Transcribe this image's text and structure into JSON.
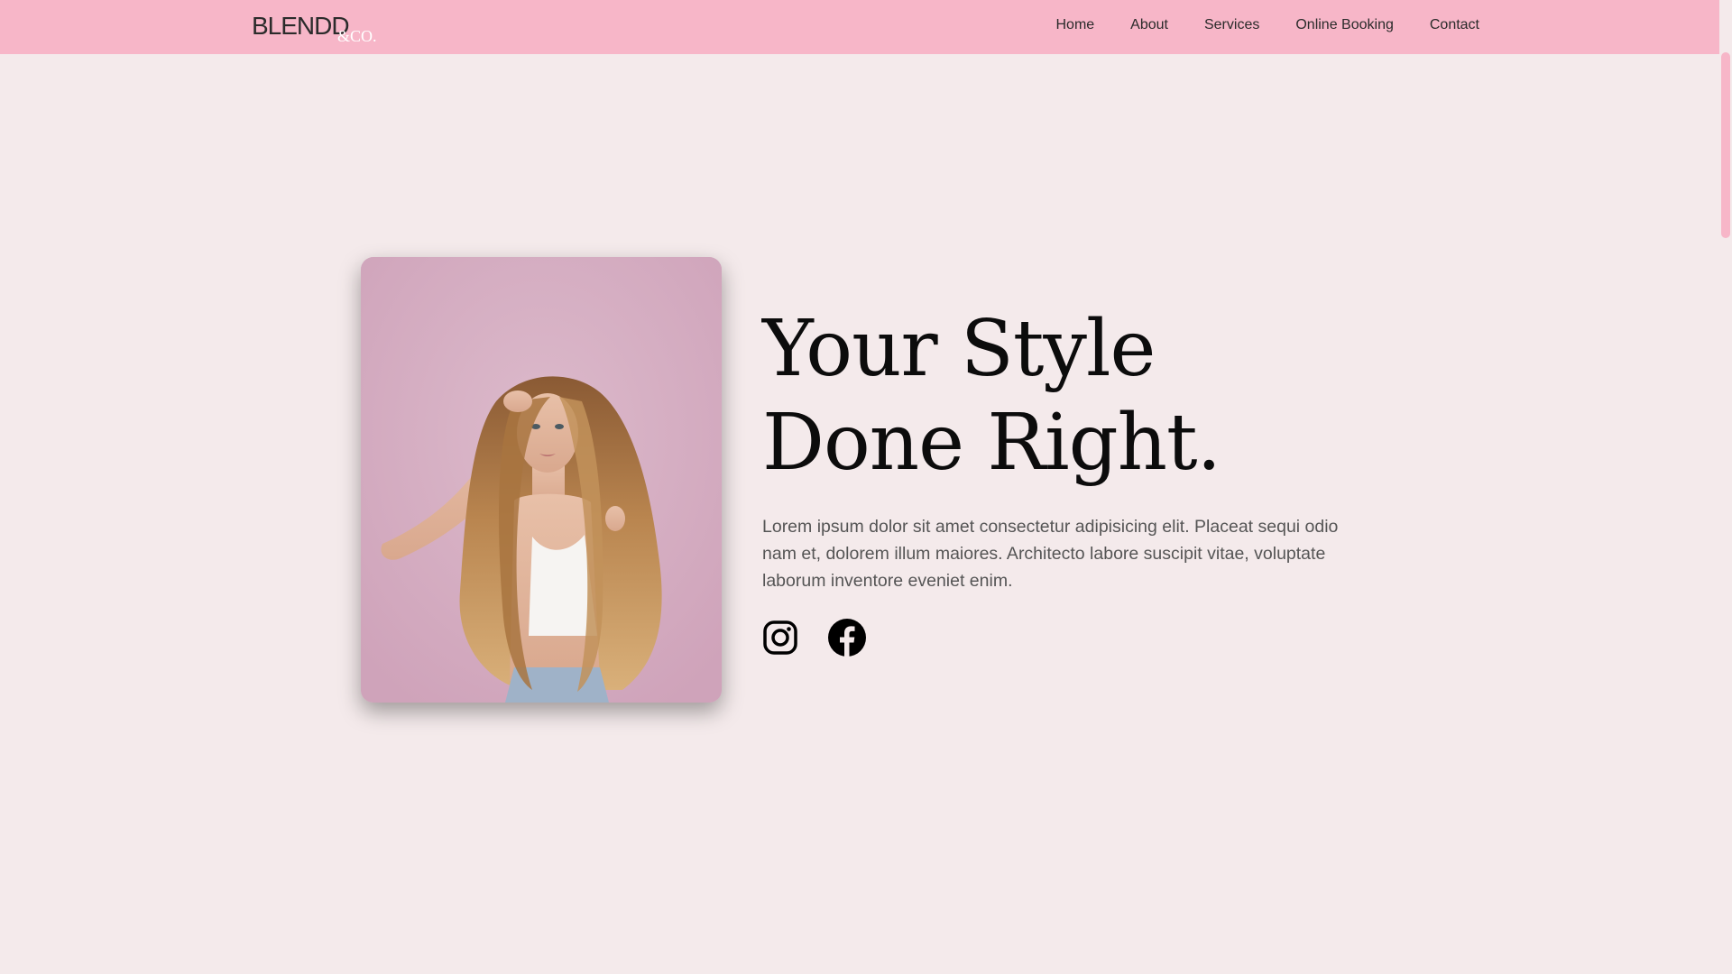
{
  "brand": {
    "logo_main": "BLENDD",
    "logo_sub": "&CO."
  },
  "nav": {
    "items": [
      {
        "label": "Home"
      },
      {
        "label": "About"
      },
      {
        "label": "Services"
      },
      {
        "label": "Online Booking"
      },
      {
        "label": "Contact"
      }
    ]
  },
  "hero": {
    "title_line1": "Your Style",
    "title_line2": "Done Right.",
    "description": "Lorem ipsum dolor sit amet consectetur adipisicing elit. Placeat sequi odio nam et, dolorem illum maiores. Architecto labore suscipit vitae, voluptate laborum inventore eveniet enim.",
    "photo_icon": "woman-portrait-photo"
  },
  "social": {
    "items": [
      {
        "icon": "instagram-icon"
      },
      {
        "icon": "facebook-icon"
      }
    ]
  },
  "colors": {
    "nav_background": "#f7b6c8",
    "page_background": "#f4eaeb",
    "title_text": "#0c0c0c",
    "body_text": "#555555"
  }
}
